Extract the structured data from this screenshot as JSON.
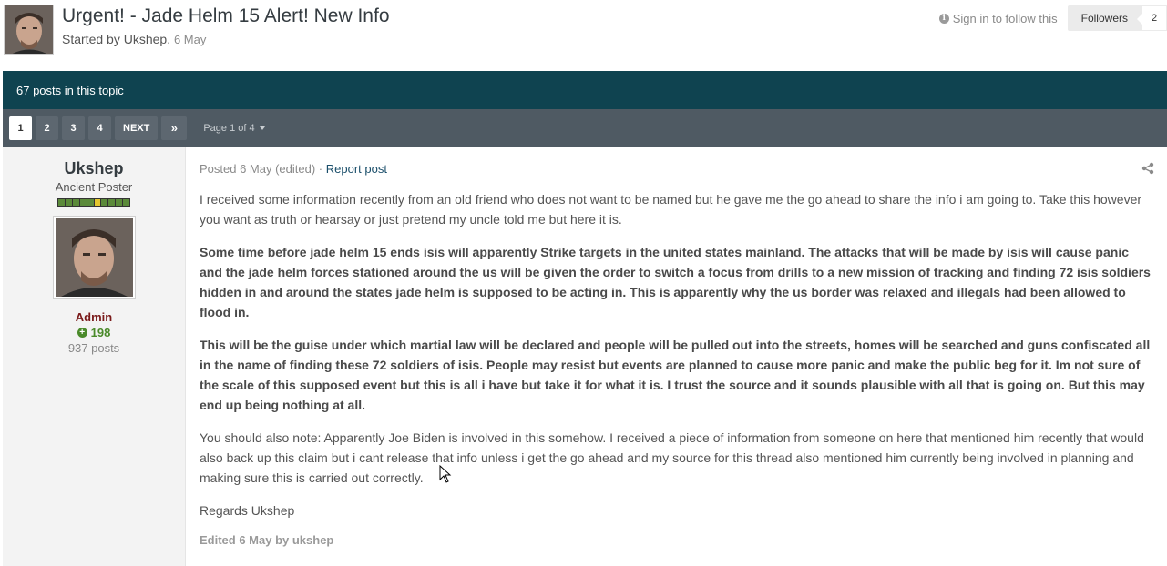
{
  "topic": {
    "title": "Urgent! - Jade Helm 15 Alert! New Info",
    "started_by_prefix": "Started by",
    "author": "Ukshep",
    "date": "6 May"
  },
  "follow": {
    "sign_in_label": "Sign in to follow this",
    "followers_label": "Followers",
    "followers_count": "2"
  },
  "posts_bar": {
    "text": "67 posts in this topic"
  },
  "pagination": {
    "pages": [
      "1",
      "2",
      "3",
      "4"
    ],
    "current": "1",
    "next_label": "NEXT",
    "last_label": "»",
    "page_of": "Page 1 of 4"
  },
  "author_panel": {
    "name": "Ukshep",
    "title": "Ancient Poster",
    "group": "Admin",
    "reputation": "198",
    "posts": "937 posts"
  },
  "post": {
    "meta": "Posted 6 May (edited) · ",
    "report_label": "Report post",
    "paragraphs": [
      "I received some information recently from an old friend who does not want to be named but he gave me the go ahead to share the info i am going to. Take this however you want as truth or hearsay or just pretend my uncle told me but here it is.",
      "Some time before jade helm 15 ends isis will apparently Strike targets in the united states mainland. The attacks that will be made by isis will cause panic and the jade helm forces stationed around the us will be given the order to switch a focus from drills to a new mission of tracking and finding 72 isis soldiers hidden in and around the states jade helm is supposed to be acting in. This is apparently why the us border was relaxed and illegals had been allowed to flood in.",
      "This will be the guise under which martial law will be declared and people will be pulled out into the streets, homes will be searched and guns confiscated all in the name of finding these 72 soldiers of isis. People may resist but events are planned to cause more panic and make the public beg for it. Im not sure of the scale of this supposed event but this is all i have but take it for what it is. I trust the source and it sounds plausible with all that is going on. But this may end up being nothing at all.",
      "You should also note: Apparently Joe Biden is involved in this somehow. I received a piece of information from someone on here that mentioned him recently that would also back up this claim but i cant release that info unless i get the go ahead and my source for this thread also mentioned him currently being involved in planning and making sure this is carried out correctly.",
      "Regards Ukshep"
    ],
    "edited": "Edited 6 May by ukshep"
  },
  "colors": {
    "posts_bar_bg": "#0f4350",
    "pagination_bg": "#4f5a63",
    "admin_color": "#7a1a1a",
    "reputation_color": "#4a8a2a"
  },
  "icons": [
    "info-icon",
    "share-icon",
    "plus-icon",
    "double-chevron-right-icon",
    "caret-down-icon",
    "mouse-cursor-icon"
  ]
}
